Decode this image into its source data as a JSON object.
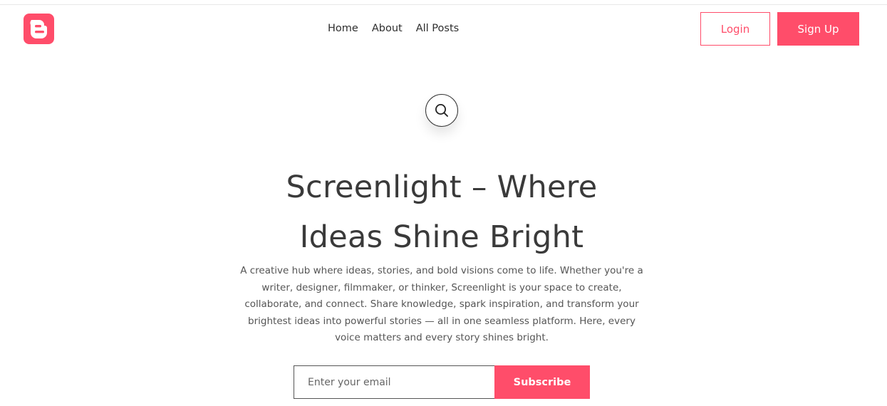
{
  "header": {
    "logo_icon": "blogger-icon",
    "nav": [
      {
        "label": "Home"
      },
      {
        "label": "About"
      },
      {
        "label": "All Posts"
      }
    ],
    "login_label": "Login",
    "signup_label": "Sign Up"
  },
  "search": {
    "icon": "search-icon"
  },
  "hero": {
    "title_line1": "Screenlight – Where",
    "title_line2": "Ideas Shine Bright",
    "description": "A creative hub where ideas, stories, and bold visions come to life. Whether you're a writer, designer, filmmaker, or thinker, Screenlight is your space to create, collaborate, and connect. Share knowledge, spark inspiration, and transform your brightest ideas into powerful stories — all in one seamless platform. Here, every voice matters and every story shines bright."
  },
  "subscribe": {
    "placeholder": "Enter your email",
    "value": "",
    "button_label": "Subscribe"
  },
  "colors": {
    "accent": "#ff4d6a",
    "text": "#3a3a3a",
    "background": "#ffffff"
  }
}
